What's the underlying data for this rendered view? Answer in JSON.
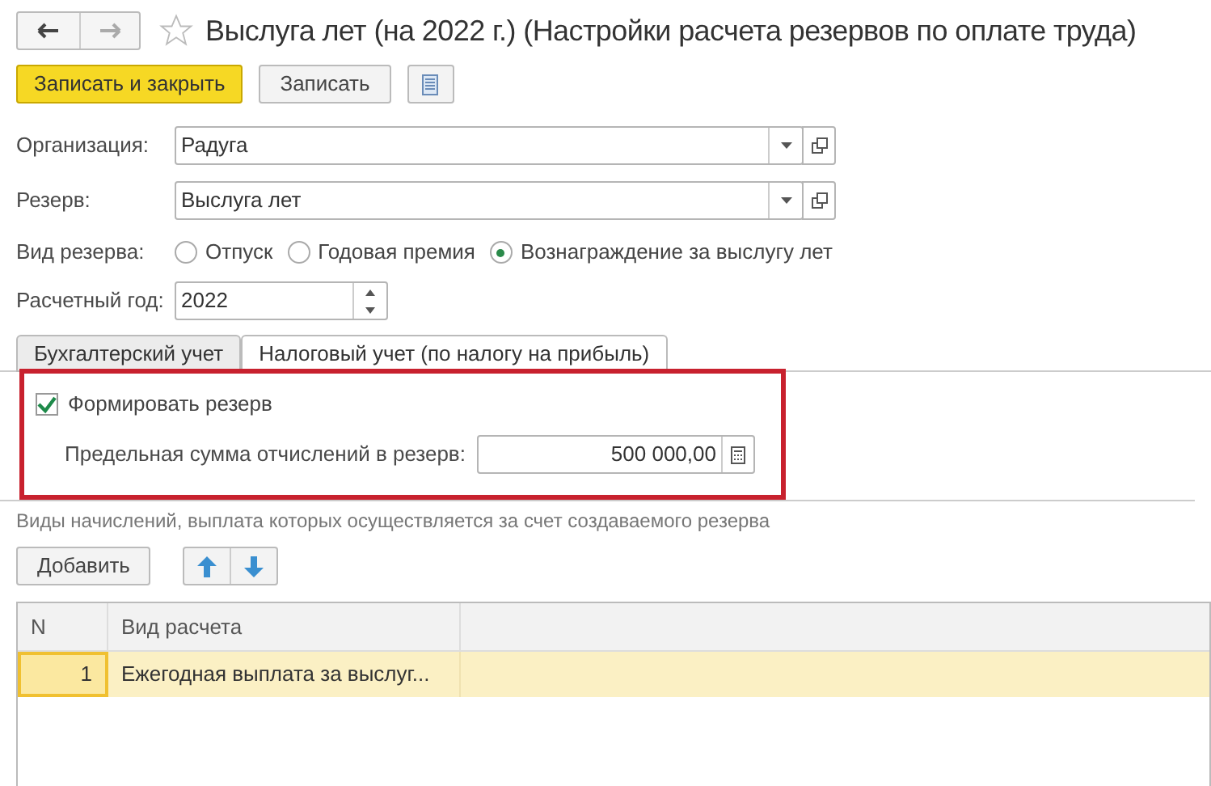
{
  "window": {
    "title": "Выслуга лет (на 2022 г.) (Настройки расчета резервов по оплате труда)",
    "favorite": false
  },
  "toolbar": {
    "buttons": [
      {
        "label": "Записать и закрыть",
        "kind": "primary"
      },
      {
        "label": "Записать",
        "kind": "normal"
      }
    ]
  },
  "form": {
    "organization": {
      "label": "Организация:",
      "value": "Радуга"
    },
    "reserve": {
      "label": "Резерв:",
      "value": "Выслуга лет"
    },
    "reserve_type": {
      "label": "Вид резерва:",
      "options": [
        {
          "label": "Отпуск",
          "selected": false
        },
        {
          "label": "Годовая премия",
          "selected": false
        },
        {
          "label": "Вознаграждение за выслугу лет",
          "selected": true
        }
      ]
    },
    "year": {
      "label": "Расчетный год:",
      "value": "2022"
    }
  },
  "tabs": [
    {
      "label": "Бухгалтерский учет",
      "selected": false
    },
    {
      "label": "Налоговый учет (по налогу на прибыль)",
      "selected": true
    }
  ],
  "tab_content": {
    "form_reserve": {
      "label": "Формировать резерв",
      "checked": true
    },
    "limit": {
      "label": "Предельная сумма отчислений в резерв:",
      "value": "500 000,00"
    },
    "highlighted": true
  },
  "accruals": {
    "caption": "Виды начислений, выплата которых осуществляется за счет создаваемого резерва",
    "add_button": "Добавить",
    "table": {
      "columns": [
        "N",
        "Вид расчета"
      ],
      "rows": [
        {
          "cells": [
            "1",
            "Ежегодная выплата за выслуг..."
          ],
          "selected": true
        }
      ]
    }
  }
}
